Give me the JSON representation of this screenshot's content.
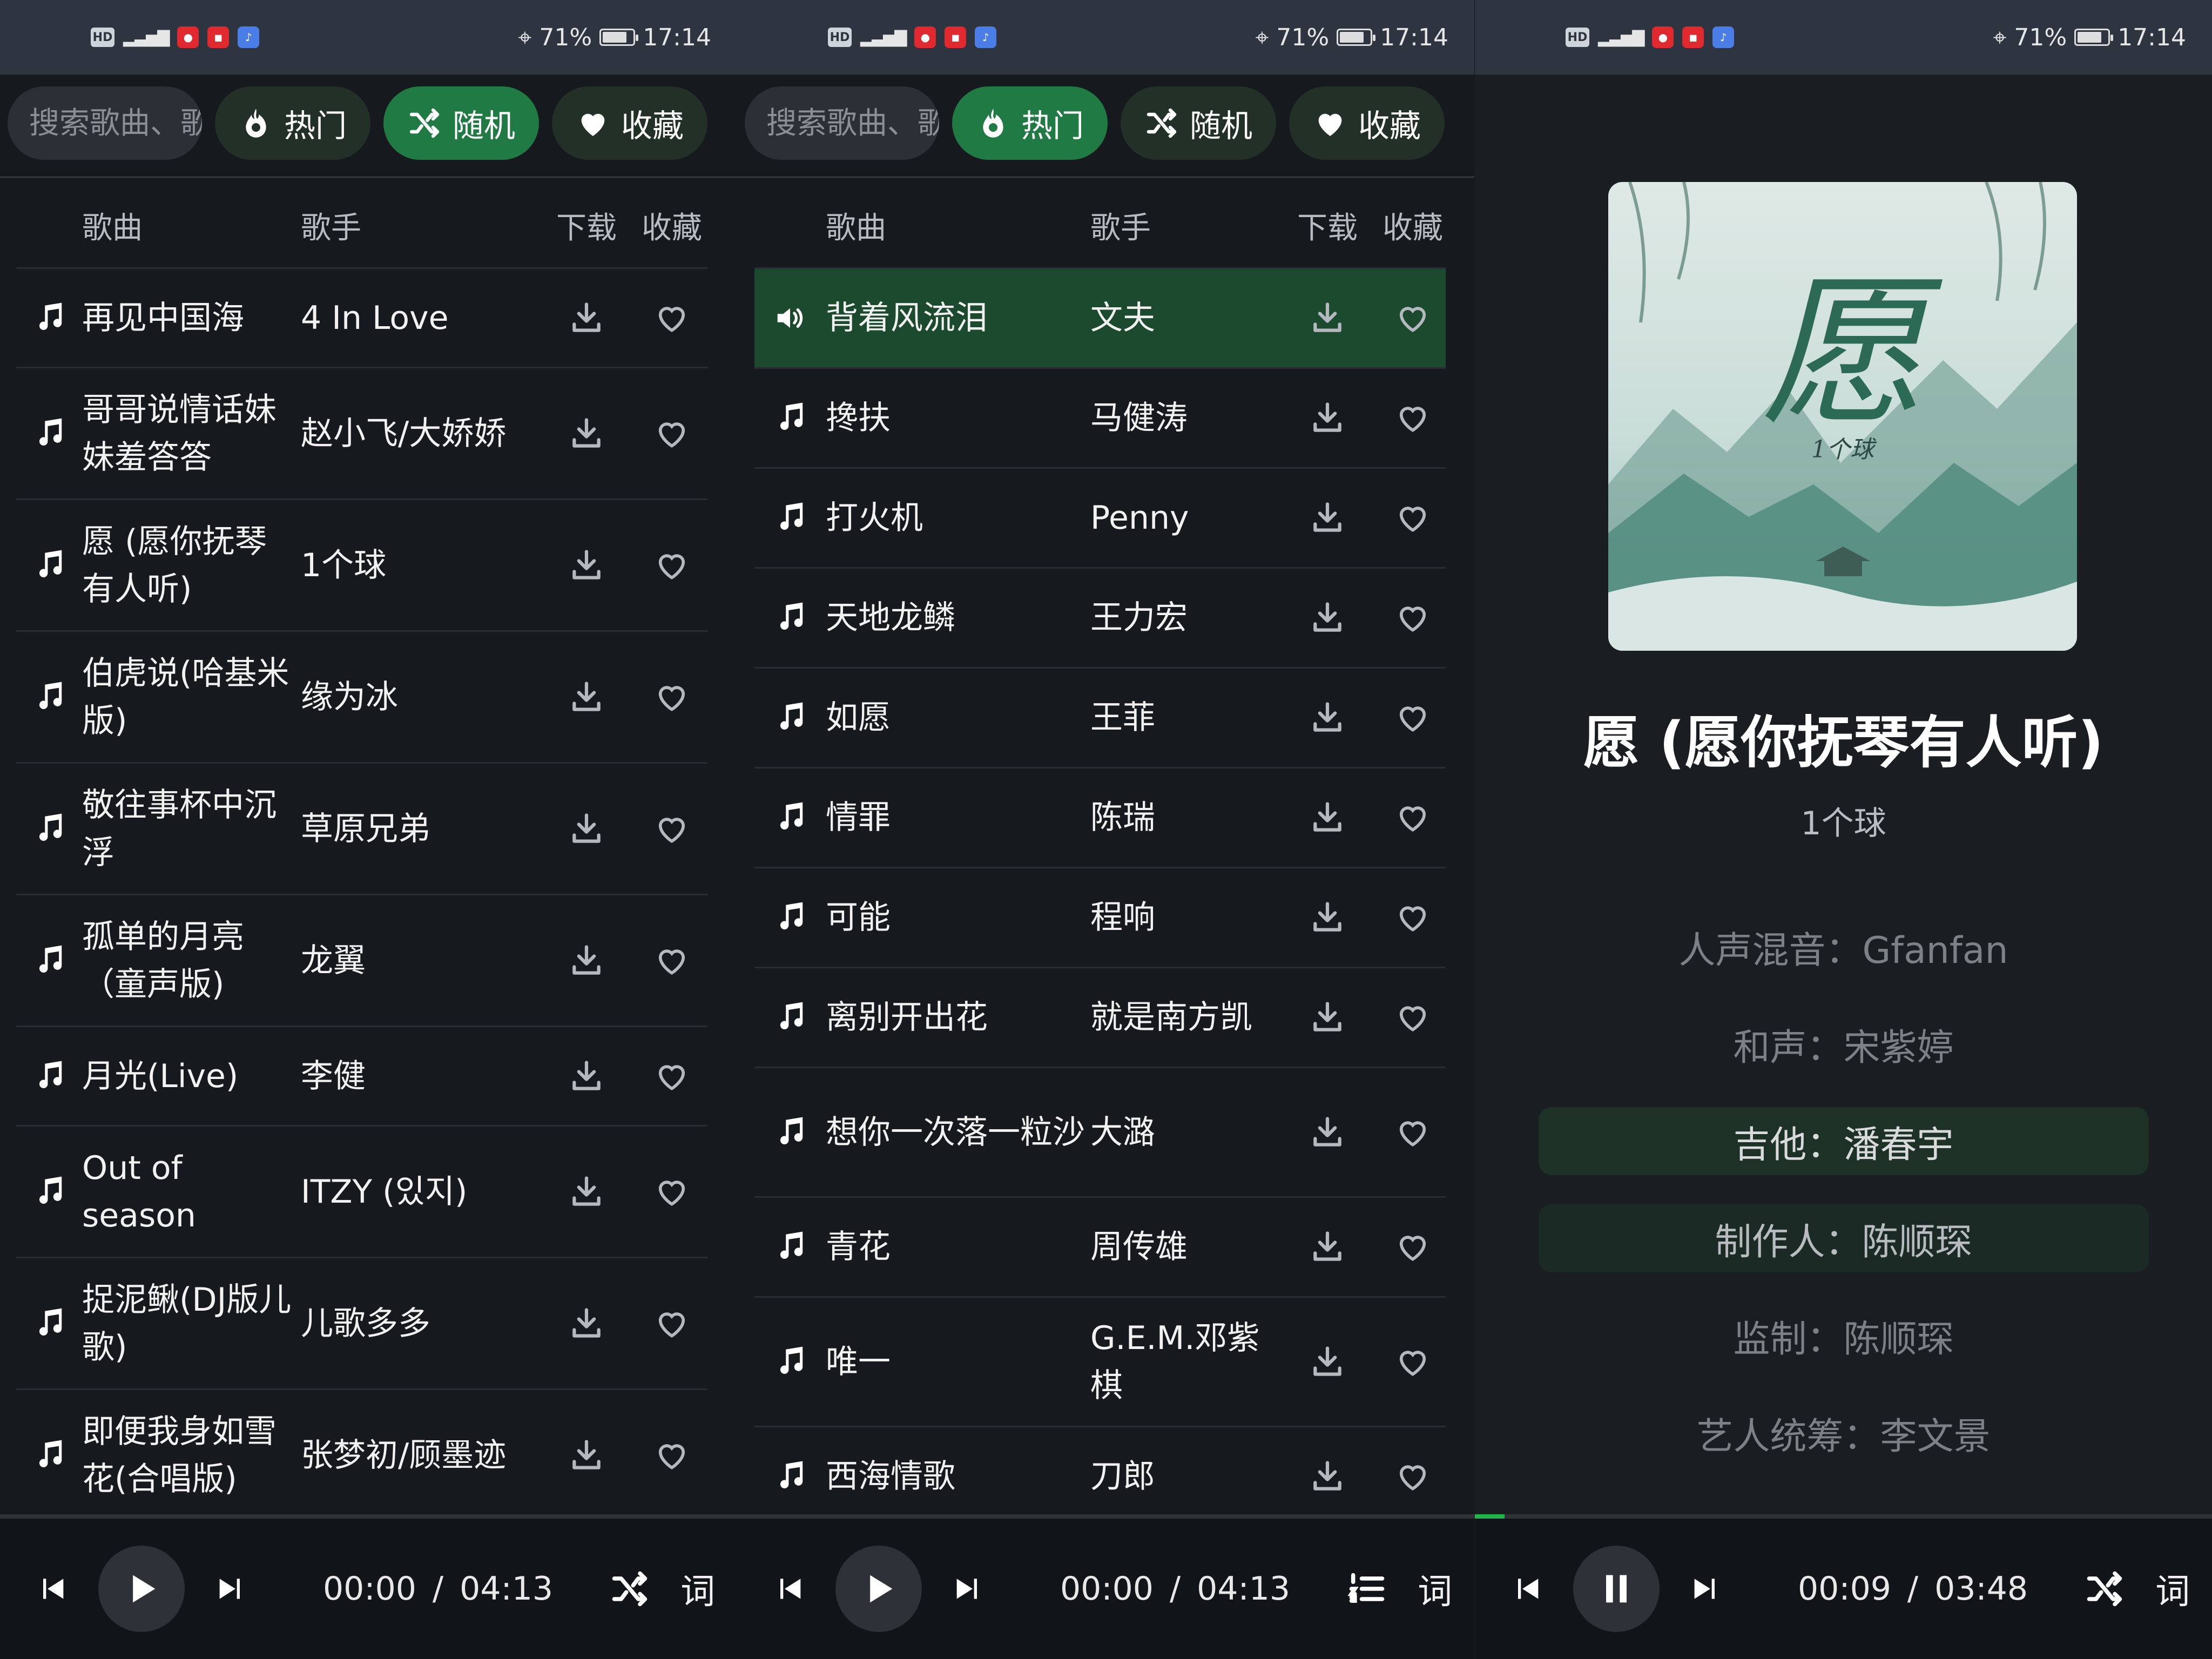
{
  "status": {
    "battery": "71%",
    "time": "17:14",
    "hd": "HD",
    "signal": "46"
  },
  "toolbar": {
    "search_placeholder": "搜索歌曲、歌",
    "hot": "热门",
    "random": "随机",
    "fav": "收藏"
  },
  "table_headers": {
    "song": "歌曲",
    "artist": "歌手",
    "download": "下载",
    "favorite": "收藏"
  },
  "list_random": [
    {
      "song": "再见中国海",
      "artist": "4 In Love"
    },
    {
      "song": "哥哥说情话妹妹羞答答",
      "artist": "赵小飞/大娇娇"
    },
    {
      "song": "愿 (愿你抚琴有人听)",
      "artist": "1个球"
    },
    {
      "song": "伯虎说(哈基米版)",
      "artist": "缘为冰"
    },
    {
      "song": "敬往事杯中沉浮",
      "artist": "草原兄弟"
    },
    {
      "song": "孤单的月亮（童声版)",
      "artist": "龙翼"
    },
    {
      "song": "月光(Live)",
      "artist": "李健"
    },
    {
      "song": "Out of season",
      "artist": "ITZY (있지)"
    },
    {
      "song": "捉泥鳅(DJ版儿歌)",
      "artist": "儿歌多多"
    },
    {
      "song": "即便我身如雪花(合唱版)",
      "artist": "张梦初/顾墨迹"
    }
  ],
  "list_hot": [
    {
      "song": "背着风流泪",
      "artist": "文夫"
    },
    {
      "song": "搀扶",
      "artist": "马健涛"
    },
    {
      "song": "打火机",
      "artist": "Penny"
    },
    {
      "song": "天地龙鳞",
      "artist": "王力宏"
    },
    {
      "song": "如愿",
      "artist": "王菲"
    },
    {
      "song": "情罪",
      "artist": "陈瑞"
    },
    {
      "song": "可能",
      "artist": "程响"
    },
    {
      "song": "离别开出花",
      "artist": "就是南方凯"
    },
    {
      "song": "想你一次落一粒沙",
      "artist": "大潞"
    },
    {
      "song": "青花",
      "artist": "周传雄"
    },
    {
      "song": "唯一",
      "artist": "G.E.M.邓紫棋"
    },
    {
      "song": "西海情歌",
      "artist": "刀郎"
    }
  ],
  "player1": {
    "elapsed": "00:00",
    "sep": "/",
    "duration": "04:13",
    "lyric_btn": "词"
  },
  "player2": {
    "elapsed": "00:00",
    "sep": "/",
    "duration": "04:13",
    "lyric_btn": "词"
  },
  "player3": {
    "elapsed": "00:09",
    "sep": "/",
    "duration": "03:48",
    "lyric_btn": "词",
    "progress": 0.04
  },
  "now_playing": {
    "cover_text": "愿",
    "cover_sub": "1个球",
    "title": "愿 (愿你抚琴有人听)",
    "artist": "1个球",
    "lyrics": [
      "人声混音：Gfanfan",
      "和声：宋紫婷",
      "吉他：潘春宇",
      "制作人：陈顺琛",
      "监制：陈顺琛",
      "艺人统筹：李文景"
    ]
  },
  "colors": {
    "accent": "#1f7a43",
    "playing_row": "#1b4a2e",
    "bg": "#16191d"
  }
}
